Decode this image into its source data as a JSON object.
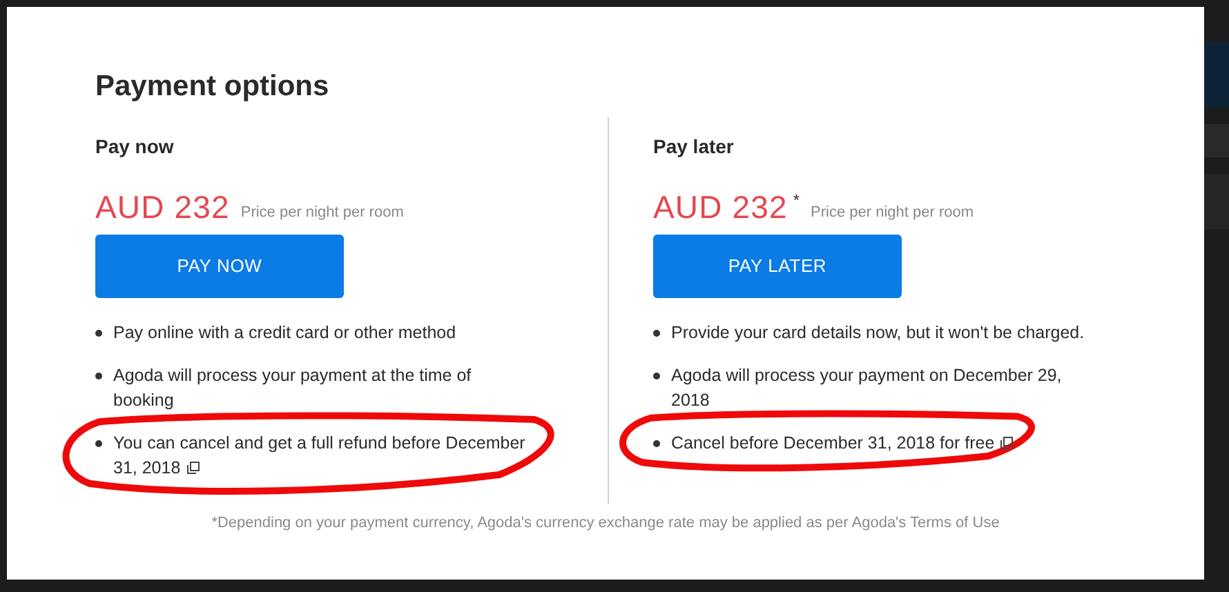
{
  "dialog": {
    "title": "Payment options"
  },
  "options": [
    {
      "heading": "Pay now",
      "price": "AUD 232",
      "price_note": "Price per night per room",
      "button": "PAY NOW",
      "bullets": [
        {
          "text": "Pay online with a credit card or other method",
          "link_icon": false,
          "circled": false
        },
        {
          "text": "Agoda will process your payment at the time of booking",
          "link_icon": false,
          "circled": false
        },
        {
          "text": "You can cancel and get a full refund before December 31, 2018",
          "link_icon": true,
          "circled": true
        }
      ]
    },
    {
      "heading": "Pay later",
      "price": "AUD 232",
      "asterisk": "*",
      "price_note": "Price per night per room",
      "button": "PAY LATER",
      "bullets": [
        {
          "text": "Provide your card details now, but it won't be charged.",
          "link_icon": false,
          "circled": false
        },
        {
          "text": "Agoda will process your payment on December 29, 2018",
          "link_icon": false,
          "circled": false
        },
        {
          "text": "Cancel before December 31, 2018 for free",
          "link_icon": true,
          "circled": true
        }
      ]
    }
  ],
  "footnote": "*Depending on your payment currency, Agoda's currency exchange rate may be applied as per Agoda's Terms of Use"
}
